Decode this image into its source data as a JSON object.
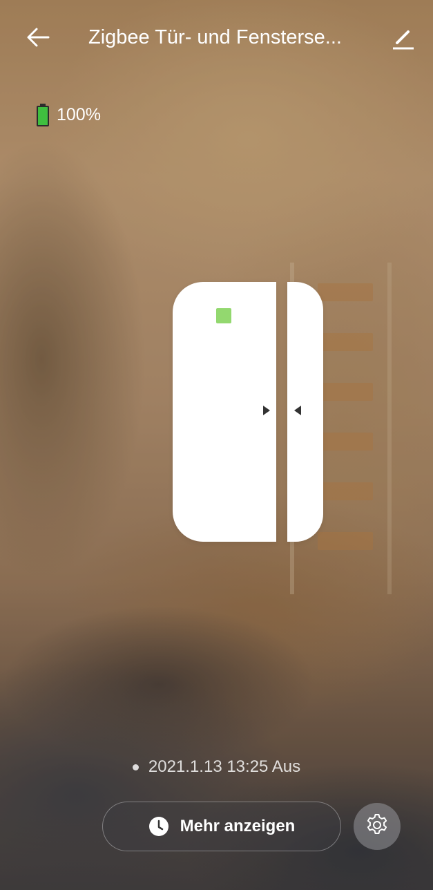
{
  "header": {
    "title": "Zigbee Tür- und Fensterse...",
    "back_icon": "back-arrow-icon",
    "edit_icon": "edit-pencil-icon"
  },
  "battery": {
    "level_text": "100%",
    "level_fraction": 1.0,
    "color": "#3fbf3f"
  },
  "device": {
    "led_color": "#93d86f",
    "body_color": "#ffffff"
  },
  "status": {
    "text": "2021.1.13 13:25 Aus"
  },
  "actions": {
    "more_label": "Mehr anzeigen",
    "more_icon": "clock-icon",
    "settings_icon": "gear-icon"
  }
}
